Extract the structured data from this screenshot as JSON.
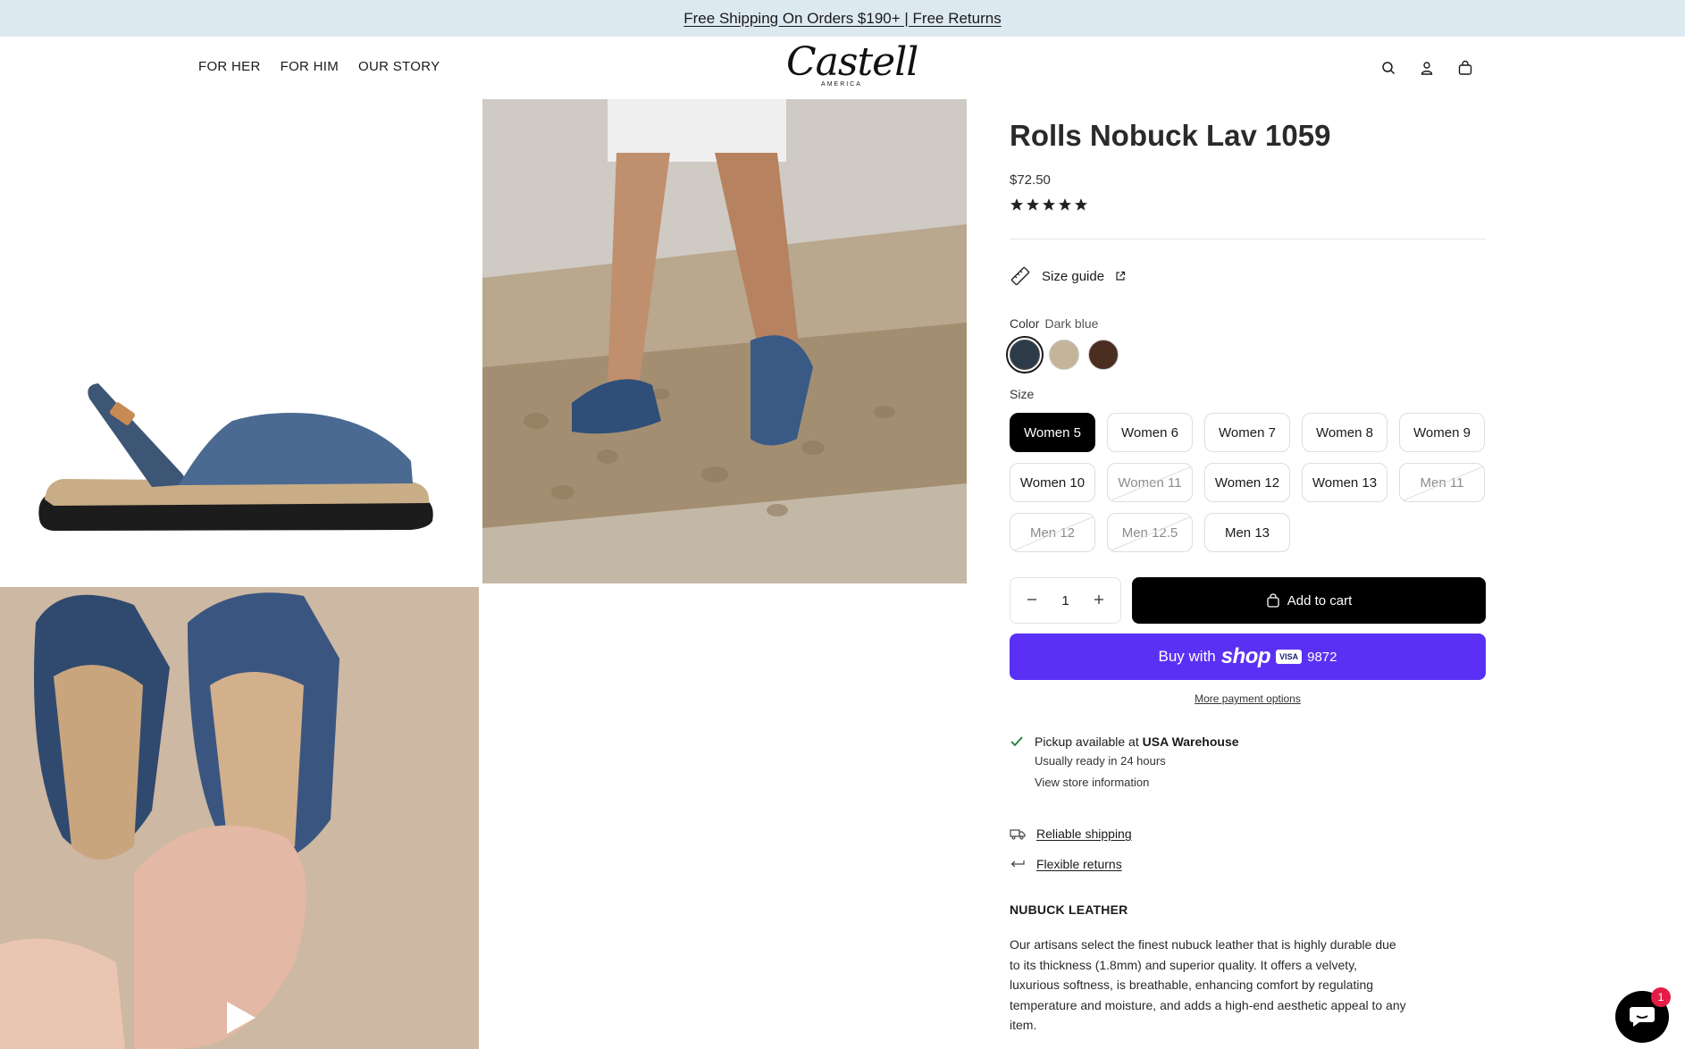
{
  "announcement": {
    "text": "Free Shipping On Orders $190+ | Free Returns"
  },
  "header": {
    "nav": [
      {
        "label": "FOR HER"
      },
      {
        "label": "FOR HIM"
      },
      {
        "label": "OUR STORY"
      }
    ],
    "logo": {
      "text": "Castell",
      "sub": "AMERICA"
    },
    "icons": [
      "search-icon",
      "account-icon",
      "cart-icon"
    ]
  },
  "product": {
    "title": "Rolls Nobuck Lav 1059",
    "price": "$72.50",
    "rating_stars": 5,
    "size_guide": "Size guide",
    "color_label": "Color",
    "color_value": "Dark blue",
    "colors": [
      "#2d3a47",
      "#c4b49a",
      "#4a2e20"
    ],
    "size_label": "Size",
    "sizes": [
      {
        "label": "Women 5",
        "state": "selected"
      },
      {
        "label": "Women 6",
        "state": "available"
      },
      {
        "label": "Women 7",
        "state": "available"
      },
      {
        "label": "Women 8",
        "state": "available"
      },
      {
        "label": "Women 9",
        "state": "available"
      },
      {
        "label": "Women 10",
        "state": "available"
      },
      {
        "label": "Women 11",
        "state": "unavailable"
      },
      {
        "label": "Women 12",
        "state": "available"
      },
      {
        "label": "Women 13",
        "state": "available"
      },
      {
        "label": "Men 11",
        "state": "unavailable"
      },
      {
        "label": "Men 12",
        "state": "unavailable"
      },
      {
        "label": "Men 12.5",
        "state": "unavailable"
      },
      {
        "label": "Men 13",
        "state": "available"
      }
    ],
    "quantity": "1",
    "add_to_cart": "Add to cart",
    "shop_pay": {
      "prefix": "Buy with",
      "brand": "shop",
      "card": "VISA",
      "digits": "9872"
    },
    "more_payment": "More payment options",
    "pickup": {
      "prefix": "Pickup available at",
      "location": "USA Warehouse",
      "ready": "Usually ready in 24 hours",
      "link": "View store information"
    },
    "features": [
      "Reliable shipping",
      "Flexible returns"
    ],
    "material_heading": "NUBUCK LEATHER",
    "description": "Our artisans select the finest nubuck leather that is highly durable due to its thickness (1.8mm) and superior quality. It offers a velvety, luxurious softness, is breathable, enhancing comfort by regulating temperature and moisture, and adds a high-end aesthetic appeal to any item."
  },
  "chat": {
    "badge": "1"
  },
  "colors": {
    "accent_shop": "#5a31f4",
    "announce_bg": "#dde9f1",
    "chat_badge": "#e51c45"
  }
}
